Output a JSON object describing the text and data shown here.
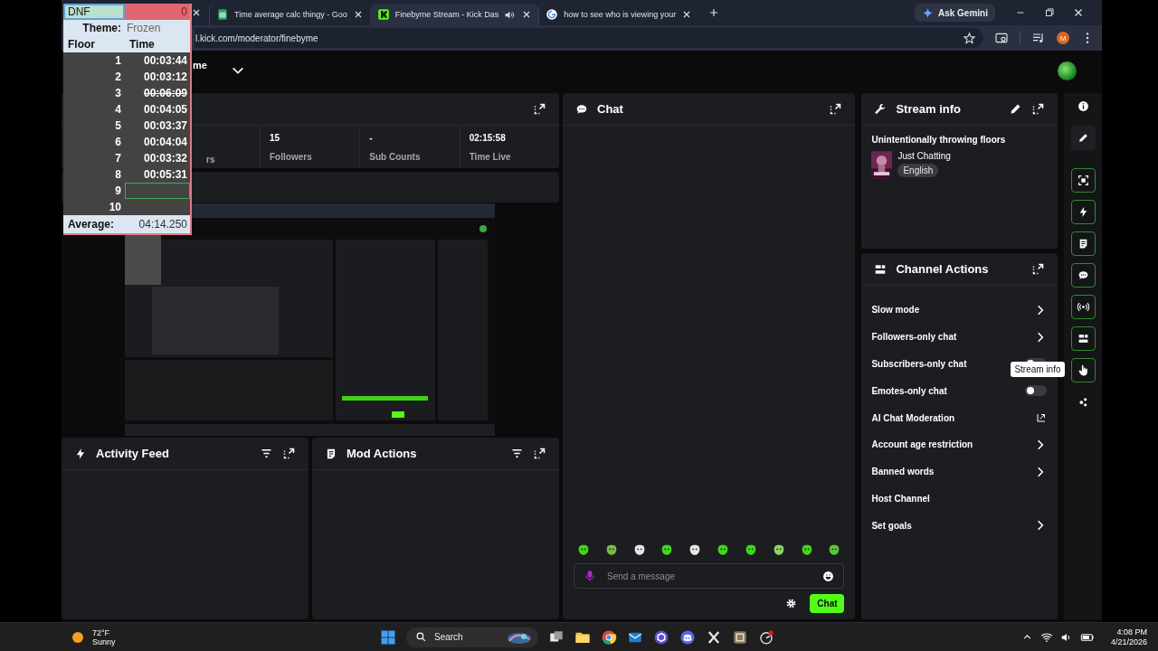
{
  "spreadsheet": {
    "status": {
      "label": "DNF",
      "count": "0"
    },
    "theme_label": "Theme:",
    "theme": "Frozen",
    "columns": [
      "Floor",
      "Time"
    ],
    "rows": [
      {
        "floor": "1",
        "time": "00:03:44",
        "struck": false,
        "selected": false
      },
      {
        "floor": "2",
        "time": "00:03:12",
        "struck": false,
        "selected": false
      },
      {
        "floor": "3",
        "time": "00:06:09",
        "struck": true,
        "selected": false
      },
      {
        "floor": "4",
        "time": "00:04:05",
        "struck": false,
        "selected": false
      },
      {
        "floor": "5",
        "time": "00:03:37",
        "struck": false,
        "selected": false
      },
      {
        "floor": "6",
        "time": "00:04:04",
        "struck": false,
        "selected": false
      },
      {
        "floor": "7",
        "time": "00:03:32",
        "struck": false,
        "selected": false
      },
      {
        "floor": "8",
        "time": "00:05:31",
        "struck": false,
        "selected": false
      },
      {
        "floor": "9",
        "selected": true
      },
      {
        "floor": "10",
        "selected": false
      }
    ],
    "average_label": "Average:",
    "average": "04:14.250"
  },
  "browser": {
    "tabs": [
      {
        "title": "Time average calc thingy - Goo",
        "selected": false,
        "audio": false
      },
      {
        "title": "Finebyme Stream - Kick Das",
        "selected": true,
        "audio": true
      },
      {
        "title": "how to see who is viewing your",
        "selected": false,
        "audio": false
      }
    ],
    "gemini": "Ask Gemini",
    "url": "l.kick.com/moderator/finebyme",
    "profile_initial": "M"
  },
  "header": {
    "channel": "me"
  },
  "stats": [
    {
      "label": "rs"
    },
    {
      "value": "15",
      "label": "Followers"
    },
    {
      "value": "-",
      "label": "Sub Counts"
    },
    {
      "value": "02:15:58",
      "label": "Time Live"
    }
  ],
  "activity_feed": {
    "title": "Activity Feed"
  },
  "mod_actions": {
    "title": "Mod Actions"
  },
  "chat": {
    "title": "Chat",
    "placeholder": "Send a message",
    "send": "Chat"
  },
  "stream_info": {
    "title": "Stream info",
    "stream_title": "Unintentionally throwing floors",
    "category": "Just Chatting",
    "language": "English"
  },
  "channel_actions": {
    "title": "Channel Actions",
    "items": [
      {
        "label": "Slow mode",
        "kind": "chevron"
      },
      {
        "label": "Followers-only chat",
        "kind": "chevron"
      },
      {
        "label": "Subscribers-only chat",
        "kind": "toggle",
        "on": false
      },
      {
        "label": "Emotes-only chat",
        "kind": "toggle",
        "on": false
      },
      {
        "label": "AI Chat Moderation",
        "kind": "external"
      },
      {
        "label": "Account age restriction",
        "kind": "chevron"
      },
      {
        "label": "Banned words",
        "kind": "chevron"
      },
      {
        "label": "Host Channel",
        "kind": "plain"
      },
      {
        "label": "Set goals",
        "kind": "chevron"
      }
    ]
  },
  "rail": [
    {
      "active": false,
      "pressed": false
    },
    {
      "active": false,
      "pressed": true
    },
    {
      "active": true,
      "pressed": false
    },
    {
      "active": true,
      "pressed": false
    },
    {
      "active": true,
      "pressed": false
    },
    {
      "active": true,
      "pressed": false
    },
    {
      "active": true,
      "pressed": false
    },
    {
      "active": true,
      "pressed": false
    },
    {
      "active": true,
      "pressed": false
    },
    {
      "active": false,
      "pressed": false
    }
  ],
  "tooltip": "Stream info",
  "taskbar": {
    "temperature": "72°F",
    "weather": "Sunny",
    "search": "Search",
    "time": "4:08 PM",
    "date": "4/21/2026"
  }
}
